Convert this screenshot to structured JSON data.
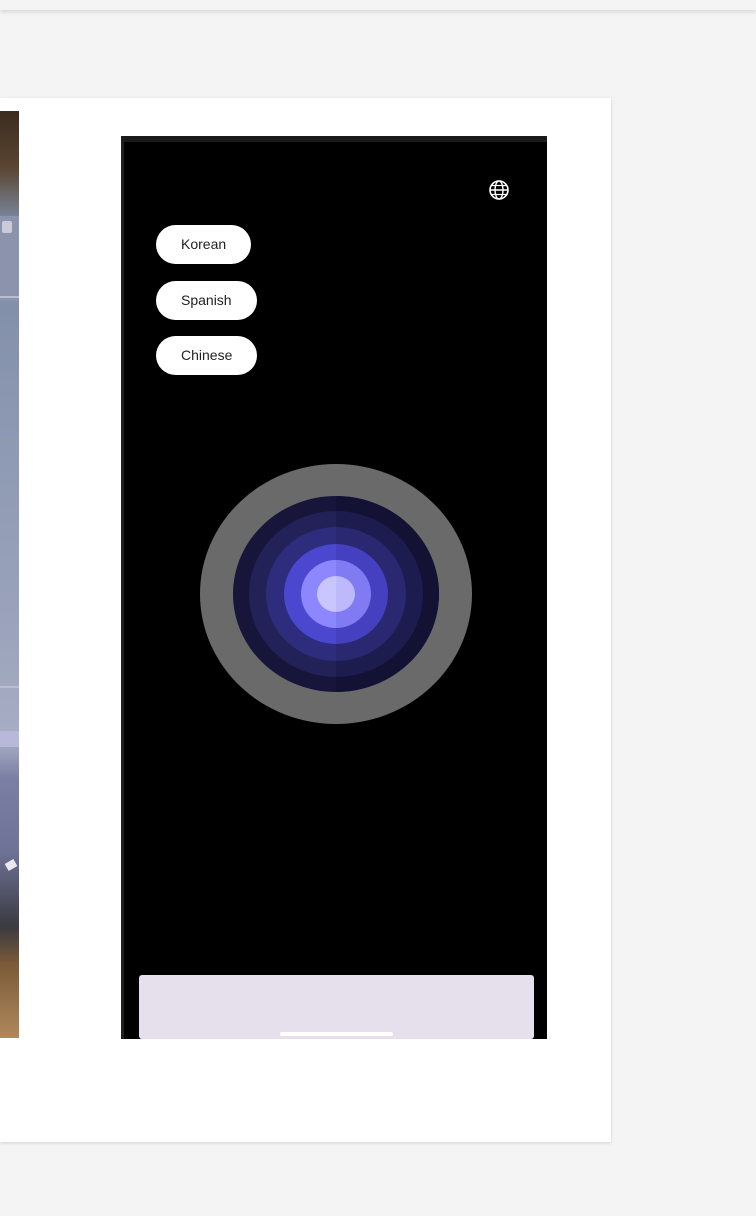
{
  "top_right_icon": "globe-icon",
  "languages": [
    {
      "label": "Korean"
    },
    {
      "label": "Spanish"
    },
    {
      "label": "Chinese"
    }
  ],
  "center_control": {
    "icon": "voice-orb-icon"
  },
  "colors": {
    "phone_background": "#000000",
    "orb_outer_ring": "#6a6a6a",
    "orb_core": "#c9c5ff",
    "bottom_panel": "#e6e0ec"
  }
}
